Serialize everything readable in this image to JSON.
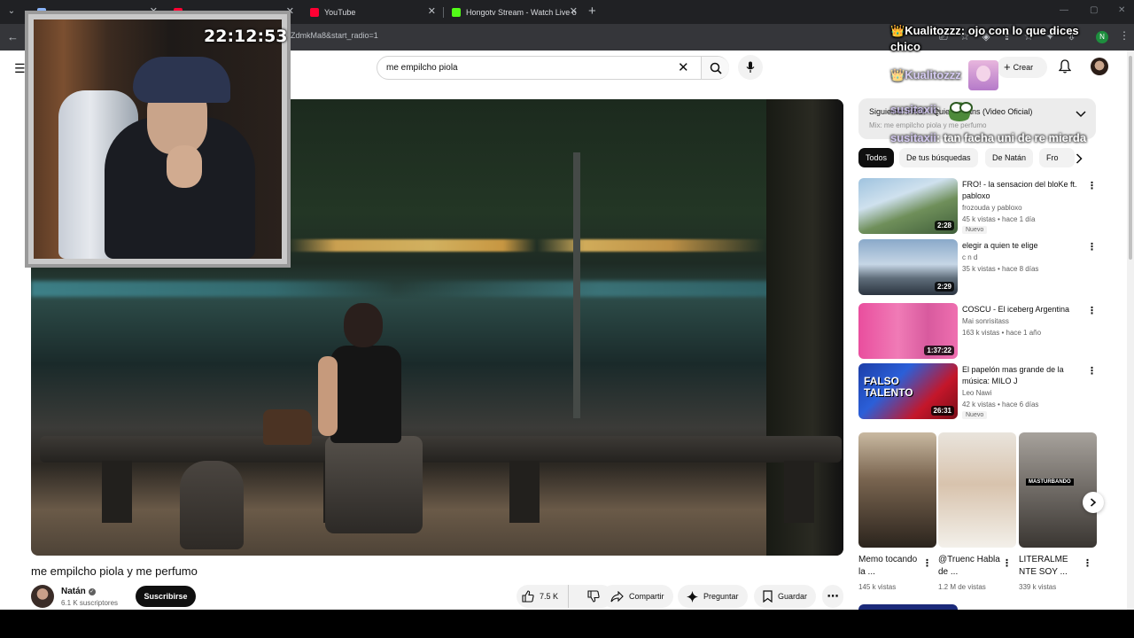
{
  "browser": {
    "tabs": [
      {
        "label": "",
        "favicon_color": "#8ab4f8"
      },
      {
        "label": "",
        "favicon_color": "#ff0033"
      },
      {
        "label": "YouTube",
        "favicon_color": "#ff0033"
      },
      {
        "label": "Hongotv Stream - Watch Live o",
        "favicon_color": "#53fc18"
      }
    ],
    "url": "ZdmkMa8&start_radio=1",
    "profile_initial": "N"
  },
  "youtube": {
    "search_query": "me empilcho piola",
    "create_label": "Crear",
    "video": {
      "title": "me empilcho piola y me perfumo",
      "channel": "Natán",
      "subscribers": "6.1 K suscriptores",
      "subscribe_label": "Suscribirse",
      "likes": "7.5 K",
      "share_label": "Compartir",
      "ask_label": "Preguntar",
      "save_label": "Guardar"
    },
    "mix": {
      "title": "Siguiente: FRO! - Quiero Jeans (Video Oficial)",
      "subtitle": "Mix: me empilcho piola y me perfumo"
    },
    "chips": [
      "Todos",
      "De tus búsquedas",
      "De Natán",
      "Fro"
    ],
    "recommendations": [
      {
        "title": "FRO! - la sensacion del bloKe ft. pabloxo",
        "channel": "frozouda y pabloxo",
        "meta": "45 k vistas • hace 1 día",
        "badge": "Nuevo",
        "duration": "2:28",
        "thumb": "linear-gradient(160deg,#9fc3df 0%,#cfe1ee 35%,#6f8f5a 60%,#3f5e3a 100%)"
      },
      {
        "title": "elegir a quien te elige",
        "channel": "c n d",
        "meta": "35 k vistas • hace 8 días",
        "badge": "",
        "duration": "2:29",
        "thumb": "linear-gradient(180deg,#8aa9c9 0%,#c6d6e6 45%,#5f6d7a 70%,#2b3440 100%)"
      },
      {
        "title": "COSCU - El iceberg Argentina",
        "channel": "Mai sonrisitass",
        "meta": "163 k vistas • hace 1 año",
        "badge": "",
        "duration": "1:37:22",
        "thumb": "linear-gradient(90deg,#e94e9e 0%,#f07bb6 40%,#d85a9e 70%,#ef6fb0 100%)"
      },
      {
        "title": "El papelón mas grande de la música: MILO J",
        "channel": "Leo Nawi",
        "meta": "42 k vistas • hace 6 días",
        "badge": "Nuevo",
        "duration": "26:31",
        "thumb": "linear-gradient(135deg,#1d3fa8 0%,#2b5fd8 35%,#c4162a 70%,#7a0d18 100%)",
        "overlay": "FALSO TALENTO"
      }
    ],
    "shorts": [
      {
        "title": "Memo tocando la ...",
        "views": "145 k vistas",
        "thumb": "linear-gradient(180deg,#c9b9a1 0%,#7a6550 40%,#2b241d 100%)",
        "caption": ""
      },
      {
        "title": "@Truenc Habla de ...",
        "views": "1.2 M de vistas",
        "thumb": "linear-gradient(180deg,#e9e4dc 0%,#d8c3ad 45%,#f3f0ea 100%)",
        "caption": ""
      },
      {
        "title": "LITERALME NTE SOY ...",
        "views": "339 k vistas",
        "thumb": "linear-gradient(180deg,#a7a29c 0%,#6f6a65 50%,#3a3632 100%)",
        "caption": "MASTURBANDO"
      }
    ]
  },
  "stream": {
    "clock": "22:12:53",
    "chat": [
      {
        "user": "Kualitozzz",
        "text": "ojo con lo que dices chico"
      },
      {
        "user": "Kualitozzz",
        "text": ""
      },
      {
        "user": "susitaxii",
        "text": ""
      },
      {
        "user": "susitaxii",
        "text": "tan facha uni de re mierda"
      }
    ]
  }
}
